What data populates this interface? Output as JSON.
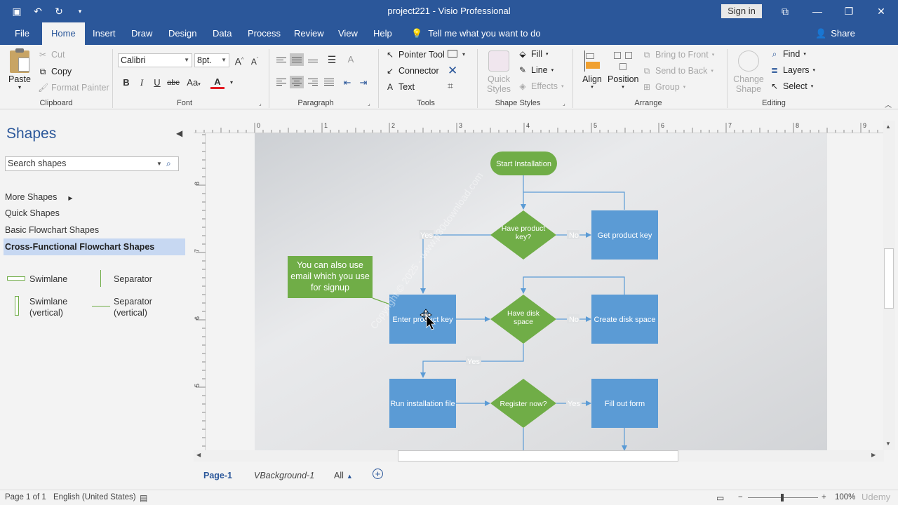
{
  "window": {
    "title": "project221  -  Visio Professional",
    "sign_in": "Sign in"
  },
  "tabs": [
    "File",
    "Home",
    "Insert",
    "Draw",
    "Design",
    "Data",
    "Process",
    "Review",
    "View",
    "Help"
  ],
  "tell_me": "Tell me what you want to do",
  "share": "Share",
  "ribbon": {
    "clipboard": {
      "label": "Clipboard",
      "paste": "Paste",
      "cut": "Cut",
      "copy": "Copy",
      "format_painter": "Format Painter"
    },
    "font": {
      "label": "Font",
      "family": "Calibri",
      "size": "8pt.",
      "bold": "B",
      "italic": "I",
      "underline": "U",
      "strike": "abc",
      "case": "Aa",
      "color_glyph": "A"
    },
    "paragraph": {
      "label": "Paragraph"
    },
    "tools": {
      "label": "Tools",
      "pointer": "Pointer Tool",
      "connector": "Connector",
      "text": "Text"
    },
    "shape_styles": {
      "label": "Shape Styles",
      "quick_styles": "Quick Styles",
      "fill": "Fill",
      "line": "Line",
      "effects": "Effects"
    },
    "arrange": {
      "label": "Arrange",
      "align": "Align",
      "position": "Position",
      "bring_front": "Bring to Front",
      "send_back": "Send to Back",
      "group": "Group"
    },
    "editing": {
      "label": "Editing",
      "change_shape": "Change Shape",
      "find": "Find",
      "layers": "Layers",
      "select": "Select"
    }
  },
  "shapes_pane": {
    "title": "Shapes",
    "search_placeholder": "Search shapes",
    "stencils": [
      "More Shapes",
      "Quick Shapes",
      "Basic Flowchart Shapes",
      "Cross-Functional Flowchart Shapes"
    ],
    "masters": {
      "swimlane": "Swimlane",
      "separator": "Separator",
      "swimlane_v": "Swimlane\n(vertical)",
      "separator_v": "Separator\n(vertical)"
    }
  },
  "ruler": {
    "h_ticks": [
      "0",
      "1",
      "2",
      "3",
      "4",
      "5",
      "6",
      "7",
      "8",
      "9"
    ],
    "v_ticks": [
      "8",
      "7",
      "6",
      "5"
    ]
  },
  "diagram": {
    "start": "Start Installation",
    "have_key": "Have product key?",
    "get_key": "Get product key",
    "enter_key": "Enter product key",
    "have_disk": "Have disk space",
    "create_disk": "Create disk space",
    "run_install": "Run installation file",
    "register": "Register now?",
    "fill_form": "Fill out form",
    "callout": "You can also use email which you use for signup",
    "yes": "Yes",
    "no": "No",
    "watermark": "Copyright © 2025 - www.p30download.com",
    "colors": {
      "green": "#70ad47",
      "blue": "#5b9bd5",
      "connector": "#5b9bd5"
    }
  },
  "pages": {
    "active": "Page-1",
    "background": "VBackground-1",
    "all": "All"
  },
  "status": {
    "page": "Page 1 of 1",
    "language": "English (United States)",
    "zoom": "100%",
    "watermark": "Udemy"
  }
}
